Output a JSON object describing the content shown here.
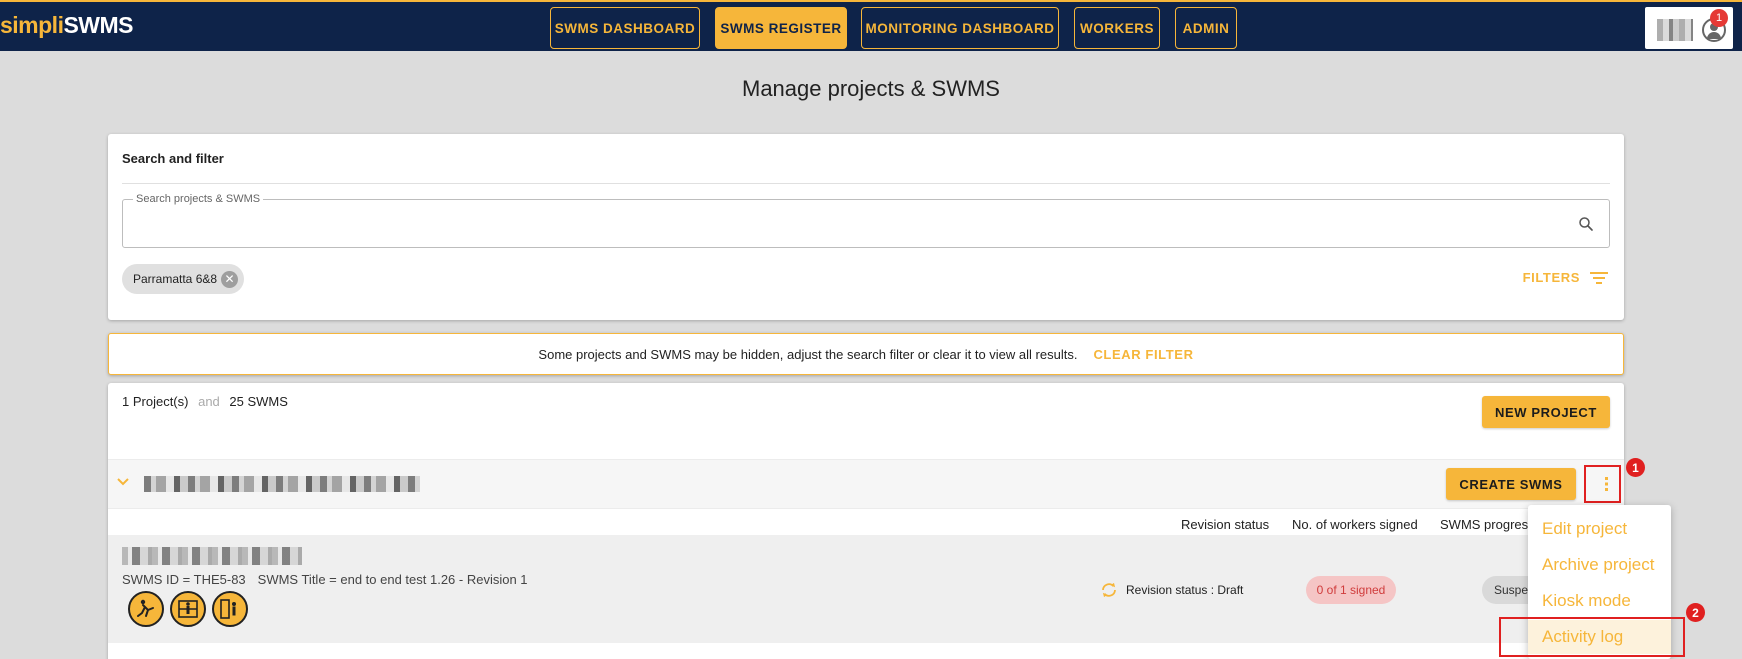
{
  "app": {
    "logo_part1": "simpli",
    "logo_part2": "SWMS"
  },
  "nav": {
    "items": [
      {
        "label": "SWMS DASHBOARD"
      },
      {
        "label": "SWMS REGISTER",
        "active": true
      },
      {
        "label": "MONITORING DASHBOARD"
      },
      {
        "label": "WORKERS"
      },
      {
        "label": "ADMIN"
      }
    ],
    "notification_count": "1"
  },
  "page": {
    "title": "Manage projects & SWMS"
  },
  "search": {
    "section_title": "Search and filter",
    "label": "Search projects & SWMS",
    "value": "",
    "chip": "Parramatta 6&8",
    "filters_label": "FILTERS"
  },
  "banner": {
    "text": "Some projects and SWMS may be hidden, adjust the search filter or clear it to view all results.",
    "clear_label": "CLEAR FILTER"
  },
  "results": {
    "projects_count": "1 Project(s)",
    "and": "and",
    "swms_count": "25 SWMS",
    "new_project_label": "NEW PROJECT",
    "create_swms_label": "CREATE SWMS",
    "columns": [
      "Revision status",
      "No. of workers signed",
      "SWMS progres"
    ],
    "swms": {
      "id_text": "SWMS ID = THE5-83",
      "title_text": "SWMS Title = end to end test 1.26 - Revision 1",
      "revision_status": "Revision status : Draft",
      "signed": "0 of 1 signed",
      "progress": "Suspe"
    }
  },
  "menu": {
    "items": [
      "Edit project",
      "Archive project",
      "Kiosk mode",
      "Activity log"
    ]
  },
  "annotations": {
    "step1": "1",
    "step2": "2"
  },
  "colors": {
    "navy": "#0e2349",
    "accent": "#f6b63a",
    "highlight": "#e02020"
  }
}
